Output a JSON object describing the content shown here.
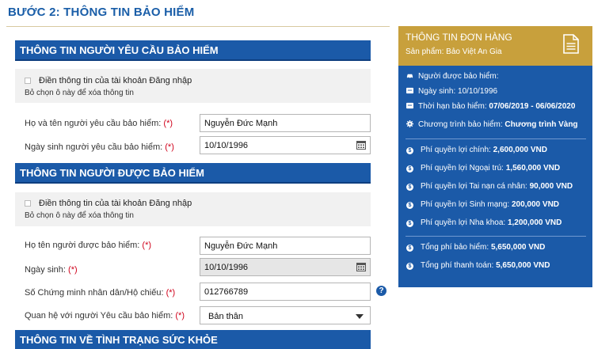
{
  "header": {
    "step_title": "BƯỚC 2: THÔNG TIN BẢO HIỂM"
  },
  "requester": {
    "section_title": "THÔNG TIN NGƯỜI YÊU CẦU BẢO HIỂM",
    "fill_from_account_label": "Điền thông tin của tài khoản Đăng nhập",
    "fill_from_account_checked": false,
    "clear_hint": "Bỏ chọn ô này để xóa thông tin",
    "name_label": "Họ và tên người yêu cầu bảo hiểm:",
    "name_value": "Nguyễn Đức Mạnh",
    "dob_label": "Ngày sinh người yêu cầu bảo hiểm:",
    "dob_value": "10/10/1996",
    "required_mark": "(*)"
  },
  "insured": {
    "section_title": "THÔNG TIN NGƯỜI ĐƯỢC BẢO HIỂM",
    "fill_from_account_label": "Điền thông tin của tài khoản Đăng nhập",
    "fill_from_account_checked": false,
    "clear_hint": "Bỏ chọn ô này để xóa thông tin",
    "name_label": "Họ tên người được bảo hiểm:",
    "name_value": "Nguyễn Đức Mạnh",
    "dob_label": "Ngày sinh:",
    "dob_value": "10/10/1996",
    "id_label": "Số Chứng minh nhân dân/Hộ chiếu:",
    "id_value": "012766789",
    "relation_label": "Quan hệ với người Yêu cầu bảo hiểm:",
    "relation_value": "Bản thân",
    "required_mark": "(*)"
  },
  "health": {
    "section_title": "THÔNG TIN VỀ TÌNH TRẠNG SỨC KHỎE"
  },
  "order": {
    "title": "THÔNG TIN ĐƠN HÀNG",
    "product": "Sản phẩm: Bảo Việt An Gia",
    "insured_label": "Người được bảo hiểm:",
    "dob": "Ngày sinh: 10/10/1996",
    "term_label": "Thời hạn bảo hiểm:",
    "term_value": "07/06/2019 - 06/06/2020",
    "program_label": "Chương trình bảo hiểm:",
    "program_value": "Chương trình Vàng",
    "fees": [
      {
        "label": "Phí quyền lợi chính:",
        "value": "2,600,000 VND"
      },
      {
        "label": "Phí quyền lợi Ngoại trú:",
        "value": "1,560,000 VND"
      },
      {
        "label": "Phí quyền lợi Tai nạn cá nhân:",
        "value": "90,000 VND"
      },
      {
        "label": "Phí quyền lợi Sinh mạng:",
        "value": "200,000 VND"
      },
      {
        "label": "Phí quyền lợi Nha khoa:",
        "value": "1,200,000 VND"
      }
    ],
    "total_premium_label": "Tổng phí bảo hiểm:",
    "total_premium_value": "5,650,000 VND",
    "total_payment_label": "Tổng phí thanh toán:",
    "total_payment_value": "5,650,000 VND"
  },
  "colors": {
    "primary_blue": "#1b5aa8",
    "gold": "#c8a03c",
    "required_red": "#d0021b"
  }
}
